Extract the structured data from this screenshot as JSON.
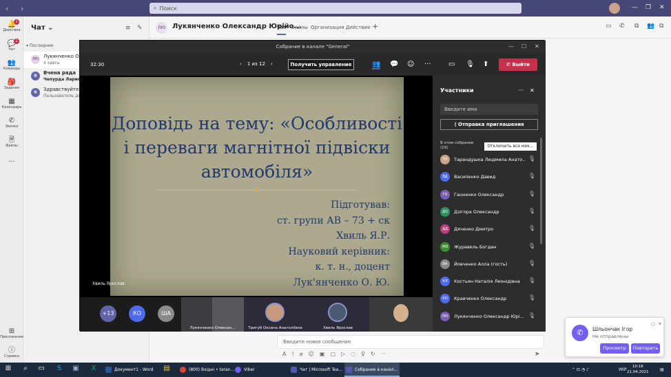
{
  "titlebar": {
    "search_placeholder": "Поиск"
  },
  "rail": [
    {
      "label": "Действия",
      "icon": "bell-icon",
      "badge": "1"
    },
    {
      "label": "Чат",
      "icon": "chat-icon",
      "badge": "1"
    },
    {
      "label": "Команды",
      "icon": "teams-icon",
      "badge": ""
    },
    {
      "label": "Задания",
      "icon": "assignments-icon",
      "badge": ""
    },
    {
      "label": "Календарь",
      "icon": "calendar-icon",
      "badge": ""
    },
    {
      "label": "Звонки",
      "icon": "phone-icon",
      "badge": ""
    },
    {
      "label": "Файлы",
      "icon": "files-icon",
      "badge": ""
    },
    {
      "label": "Приложения",
      "icon": "apps-icon",
      "badge": ""
    },
    {
      "label": "Справка",
      "icon": "help-icon",
      "badge": ""
    }
  ],
  "chatlist": {
    "title": "Чат",
    "section": "Последние",
    "items": [
      {
        "avatar": "ЛЮ",
        "name": "Лукянченко Оле...",
        "sub": "я здесь"
      },
      {
        "avatar": "",
        "name": "Вчена рада",
        "sub": "Чепурда Лариса М..."
      },
      {
        "avatar": "",
        "name": "Здравствуйте",
        "sub": "Пользователь доб..."
      }
    ]
  },
  "header": {
    "avatar": "ЛЮ",
    "title": "Лукянченко Олександр Юрійо...",
    "tabs": [
      "Чат",
      "Файлы",
      "Организация",
      "Действия"
    ],
    "add": "+"
  },
  "compose": {
    "placeholder": "Введите новое сообщение"
  },
  "meeting": {
    "window_title": "Собрание в канале \"General\"",
    "time": "32:30",
    "pager": "1 из 12",
    "get_control": "Получить управление",
    "leave": "Выйти",
    "speaker": "Хвиль Ярослав",
    "slide": {
      "title_lines": [
        "Доповідь на тему: «Особливості",
        "і переваги магнітної підвіски",
        "автомобіля»"
      ],
      "body_lines": [
        "Підготував:",
        "ст. групи АВ – 73 + ск",
        "Хвиль Я.Р.",
        "Науковий керівник:",
        "к. т. н., доцент",
        "Лук'янченко О. Ю."
      ]
    },
    "strip": {
      "circles": [
        {
          "text": "+13",
          "color": "#6264a7"
        },
        {
          "text": "КО",
          "color": "#4f6bed"
        },
        {
          "text": "ША",
          "color": "#8a8a8a"
        }
      ],
      "videos": [
        {
          "label": "Лукянченко Олексан...",
          "bg": "#4a4a4a"
        },
        {
          "label": "Тригуб Оксана Анатоліївна",
          "bg": "#2b2b3a"
        },
        {
          "label": "Хвиль Ярослав",
          "bg": "#2b2b3a"
        },
        {
          "label": "",
          "bg": "#3a3a3a"
        }
      ]
    },
    "people": {
      "title": "Участники",
      "name_placeholder": "Введите имя",
      "invite": "Отправка приглашения",
      "in_meeting": "В этом собрании",
      "count": "(19)",
      "mute_all": "Отключить все мик...",
      "list": [
        {
          "av": "ТЛ",
          "name": "Тарандушка Людмила Анато...",
          "color": "#c9a48a"
        },
        {
          "av": "ВД",
          "name": "Василенко Давид",
          "color": "#4f6bed"
        },
        {
          "av": "ГО",
          "name": "Ганненко Олександр",
          "color": "#7a5fb0"
        },
        {
          "av": "ДО",
          "name": "Дзігора Олександр",
          "color": "#2f8f63"
        },
        {
          "av": "ДД",
          "name": "Дяченко Дмитро",
          "color": "#b5417b"
        },
        {
          "av": "ЖБ",
          "name": "Журавель Богдан",
          "color": "#3d8f2f"
        },
        {
          "av": "ЙА",
          "name": "Йовченко Алла (гость)",
          "color": "#8a8a8a"
        },
        {
          "av": "КЛ",
          "name": "Костьян Наталія Леонідівна",
          "color": "#4f6bed"
        },
        {
          "av": "КО",
          "name": "Кравченко Олександр",
          "color": "#4f6bed"
        },
        {
          "av": "ЛЮ",
          "name": "Лукянченко Олександр Юрі...",
          "color": "#7a5fb0"
        }
      ]
    }
  },
  "toast": {
    "name": "Шльончак Ігор",
    "status": "Не отправлены",
    "view": "Просмотр",
    "retry": "Повторить"
  },
  "taskbar": {
    "apps": [
      {
        "label": "Документ1 - Word",
        "color": "#2b579a"
      },
      {
        "label": "(800) Вхідні • taran...",
        "color": "#db4437"
      },
      {
        "label": "Viber",
        "color": "#7360f2"
      },
      {
        "label": "Чат | Microsoft Tea...",
        "color": "#5558af"
      },
      {
        "label": "Собрание в канал...",
        "color": "#5558af"
      }
    ],
    "lang": "УКР",
    "time": "10:18",
    "date": "21.04.2021"
  }
}
